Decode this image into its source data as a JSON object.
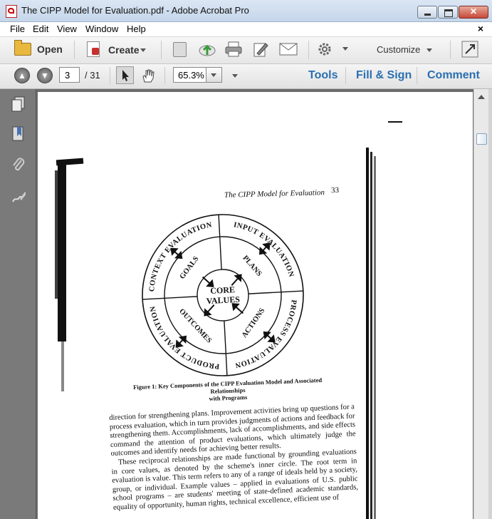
{
  "window": {
    "title": "The CIPP Model for Evaluation.pdf - Adobe Acrobat Pro"
  },
  "menu": {
    "items": [
      "File",
      "Edit",
      "View",
      "Window",
      "Help"
    ],
    "close_glyph": "×"
  },
  "toolbar": {
    "open_label": "Open",
    "create_label": "Create",
    "customize_label": "Customize",
    "icons": [
      "folder-icon",
      "create-pdf-icon",
      "save-icon",
      "cloud-upload-icon",
      "print-icon",
      "edit-icon",
      "email-icon",
      "gear-icon",
      "fullscreen-icon"
    ]
  },
  "nav": {
    "current_page": "3",
    "page_total": "/ 31",
    "zoom": "65.3%"
  },
  "panes": {
    "tools": "Tools",
    "fill_sign": "Fill & Sign",
    "comment": "Comment"
  },
  "left_pane": {
    "icons": [
      "pages-icon",
      "bookmark-icon",
      "attachment-icon",
      "signature-icon"
    ]
  },
  "document": {
    "header": "The CIPP Model for Evaluation",
    "page_number": "33",
    "diagram": {
      "center": [
        "CORE",
        "VALUES"
      ],
      "inner": [
        "GOALS",
        "PLANS",
        "ACTIONS",
        "OUTCOMES"
      ],
      "outer": [
        "CONTEXT EVALUATION",
        "INPUT EVALUATION",
        "PROCESS EVALUATION",
        "PRODUCT EVALUATION"
      ]
    },
    "caption_line1": "Figure 1:   Key Components of the CIPP Evaluation Model and Associated Relationships",
    "caption_line2": "with Programs",
    "paragraph1": "direction for strengthening plans. Improvement activities bring up questions for a process evaluation, which in turn provides judgments of actions and feedback for strengthening them. Accomplishments, lack of accomplishments, and side effects command the attention of product evaluations, which ultimately judge the outcomes and identify needs for achieving better results.",
    "paragraph2": "These reciprocal relationships are made functional by grounding evaluations in core values, as denoted by the scheme's inner circle. The root term in evaluation is value. This term refers to any of a range of ideals held by a society, group, or individual. Example values – applied in evaluations of U.S. public school programs – are students' meeting of state-defined academic standards, equality of opportunity, human rights, technical excellence, efficient use of"
  },
  "colors": {
    "accent": "#2a6fb0",
    "background": "#6c6c6c"
  }
}
